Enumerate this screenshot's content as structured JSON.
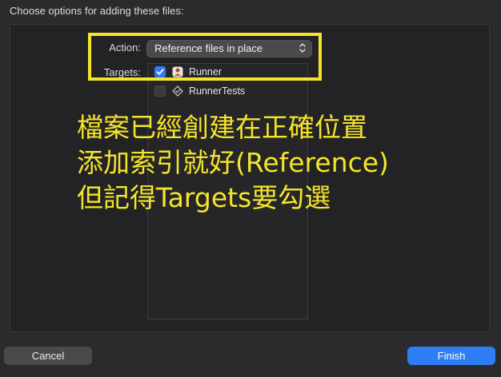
{
  "dialog": {
    "title": "Choose options for adding these files:"
  },
  "action": {
    "label": "Action:",
    "selected": "Reference files in place"
  },
  "targets": {
    "label": "Targets:",
    "items": [
      {
        "name": "Runner",
        "checked": true,
        "icon": "app-target-icon"
      },
      {
        "name": "RunnerTests",
        "checked": false,
        "icon": "test-target-icon"
      }
    ]
  },
  "annotation": {
    "lines": [
      "檔案已經創建在正確位置",
      "添加索引就好(Reference)",
      "但記得Targets要勾選"
    ],
    "color": "#f5e52a"
  },
  "buttons": {
    "cancel": "Cancel",
    "finish": "Finish"
  },
  "colors": {
    "accent": "#2f7df6",
    "highlight": "#f5e52a"
  }
}
